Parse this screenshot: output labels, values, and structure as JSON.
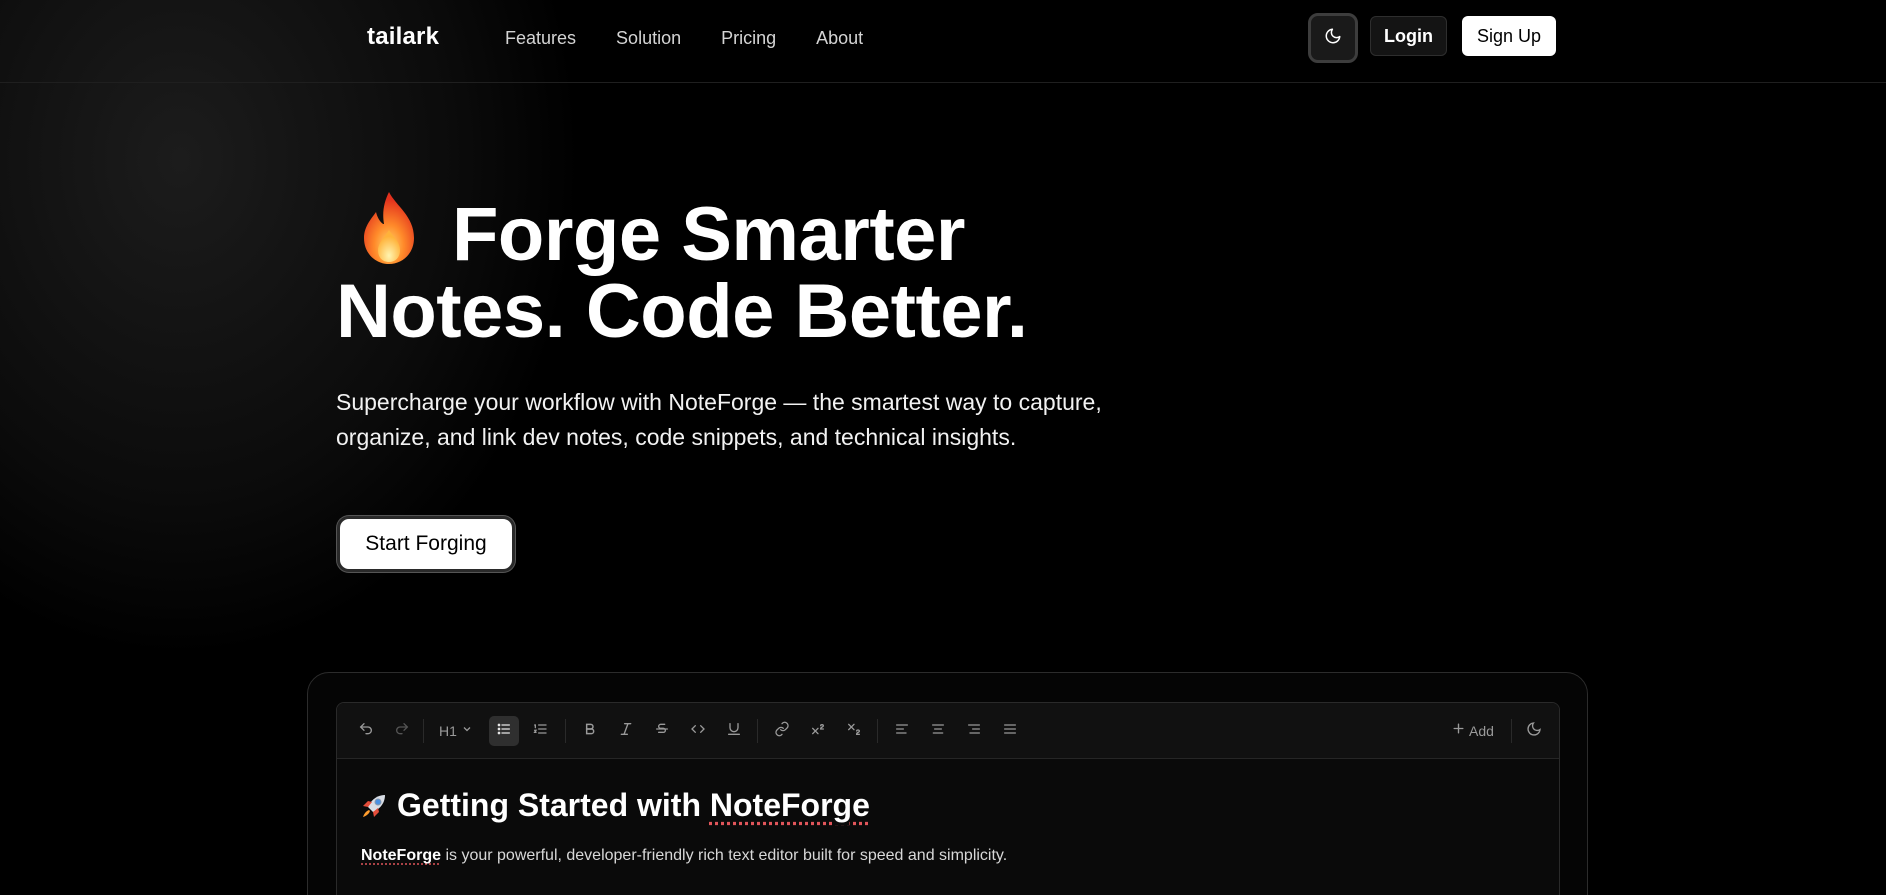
{
  "header": {
    "brand": "tailark",
    "nav": [
      "Features",
      "Solution",
      "Pricing",
      "About"
    ],
    "login_label": "Login",
    "signup_label": "Sign Up"
  },
  "hero": {
    "title_line1": "Forge Smarter",
    "title_line2": "Notes. Code Better.",
    "subtitle": "Supercharge your workflow with NoteForge — the smartest way to capture, organize, and link dev notes, code snippets, and technical insights.",
    "cta_label": "Start Forging"
  },
  "editor": {
    "heading_select": "H1",
    "add_label": "Add",
    "doc_title_prefix": "Getting Started with ",
    "doc_title_word": "NoteForge",
    "doc_para_bold": "NoteForge",
    "doc_para_rest": " is your powerful, developer-friendly rich text editor built for speed and simplicity."
  },
  "colors": {
    "background": "#000000",
    "accent_logo": "#60a5fa",
    "spellcheck": "#e0555a"
  }
}
